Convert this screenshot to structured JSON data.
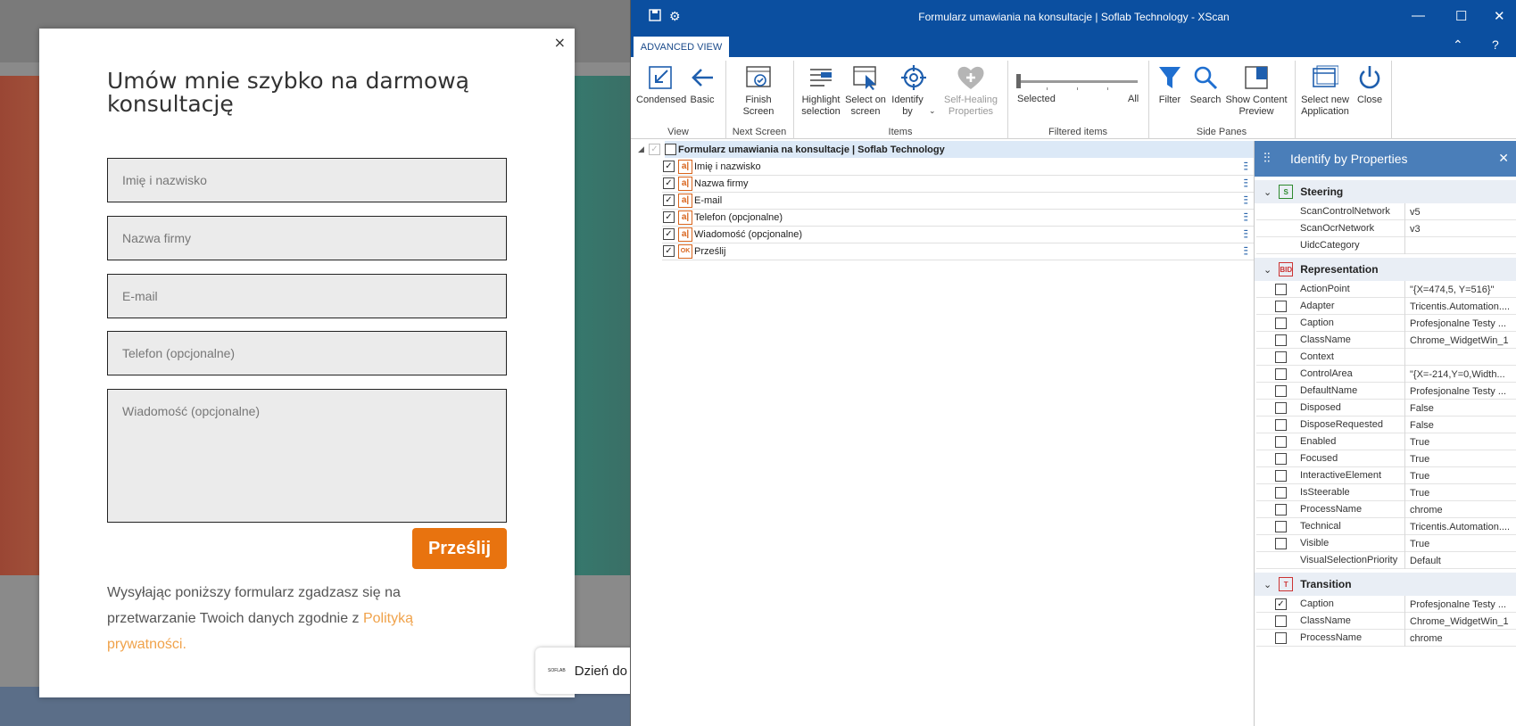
{
  "website": {
    "close_glyph": "×",
    "heading": "Umów mnie szybko na darmową konsultację",
    "fields": [
      {
        "placeholder": "Imię i nazwisko"
      },
      {
        "placeholder": "Nazwa firmy"
      },
      {
        "placeholder": "E-mail"
      },
      {
        "placeholder": "Telefon (opcjonalne)"
      },
      {
        "placeholder": "Wiadomość (opcjonalne)"
      }
    ],
    "submit_label": "Prześlij",
    "consent_text": "Wysyłając poniższy formularz zgadzasz się na przetwarzanie Twoich danych zgodnie z",
    "consent_link": "Polityką prywatności.",
    "toast_logo": "SOFLAB",
    "toast_text": "Dzień do"
  },
  "xscan": {
    "window_title": "Formularz umawiania na konsultacje | Soflab Technology - XScan",
    "active_tab": "ADVANCED VIEW",
    "ribbon": {
      "condensed": "Condensed",
      "basic": "Basic",
      "view_group": "View",
      "finish_screen": "Finish Screen",
      "next_screen_group": "Next Screen",
      "highlight_selection": "Highlight selection",
      "select_on_screen": "Select on screen",
      "identify_by": "Identify by",
      "self_healing": "Self-Healing Properties",
      "items_group": "Items",
      "selected": "Selected",
      "all": "All",
      "filtered_items_group": "Filtered items",
      "filter": "Filter",
      "search": "Search",
      "show_content_preview": "Show Content Preview",
      "select_new_application": "Select new Application",
      "close": "Close",
      "side_panes_group": "Side Panes"
    },
    "tree": {
      "root": "Formularz umawiania na konsultacje | Soflab Technology",
      "items": [
        {
          "label": "Imię i nazwisko",
          "icon": "a|",
          "checked": true
        },
        {
          "label": "Nazwa firmy",
          "icon": "a|",
          "checked": true
        },
        {
          "label": "E-mail",
          "icon": "a|",
          "checked": true
        },
        {
          "label": "Telefon (opcjonalne)",
          "icon": "a|",
          "checked": true
        },
        {
          "label": "Wiadomość (opcjonalne)",
          "icon": "a|",
          "checked": true
        },
        {
          "label": "Prześlij",
          "icon": "OK",
          "checked": true
        }
      ]
    },
    "panel": {
      "title": "Identify by Properties",
      "sections": [
        {
          "name": "Steering",
          "icon": "S",
          "rows": [
            {
              "name": "ScanControlNetwork",
              "value": "v5",
              "checkbox": false
            },
            {
              "name": "ScanOcrNetwork",
              "value": "v3",
              "checkbox": false
            },
            {
              "name": "UidcCategory",
              "value": "",
              "checkbox": false
            }
          ]
        },
        {
          "name": "Representation",
          "icon": "BID",
          "rows": [
            {
              "name": "ActionPoint",
              "value": "\"{X=474,5, Y=516}\"",
              "checkbox": true,
              "checked": false
            },
            {
              "name": "Adapter",
              "value": "Tricentis.Automation....",
              "checkbox": true,
              "checked": false
            },
            {
              "name": "Caption",
              "value": "Profesjonalne Testy ...",
              "checkbox": true,
              "checked": false
            },
            {
              "name": "ClassName",
              "value": "Chrome_WidgetWin_1",
              "checkbox": true,
              "checked": false
            },
            {
              "name": "Context",
              "value": "",
              "checkbox": true,
              "checked": false
            },
            {
              "name": "ControlArea",
              "value": "\"{X=-214,Y=0,Width...",
              "checkbox": true,
              "checked": false
            },
            {
              "name": "DefaultName",
              "value": "Profesjonalne Testy ...",
              "checkbox": true,
              "checked": false
            },
            {
              "name": "Disposed",
              "value": "False",
              "checkbox": true,
              "checked": false
            },
            {
              "name": "DisposeRequested",
              "value": "False",
              "checkbox": true,
              "checked": false
            },
            {
              "name": "Enabled",
              "value": "True",
              "checkbox": true,
              "checked": false
            },
            {
              "name": "Focused",
              "value": "True",
              "checkbox": true,
              "checked": false
            },
            {
              "name": "InteractiveElement",
              "value": "True",
              "checkbox": true,
              "checked": false
            },
            {
              "name": "IsSteerable",
              "value": "True",
              "checkbox": true,
              "checked": false
            },
            {
              "name": "ProcessName",
              "value": "chrome",
              "checkbox": true,
              "checked": false
            },
            {
              "name": "Technical",
              "value": "Tricentis.Automation....",
              "checkbox": true,
              "checked": false
            },
            {
              "name": "Visible",
              "value": "True",
              "checkbox": true,
              "checked": false
            },
            {
              "name": "VisualSelectionPriority",
              "value": "Default",
              "checkbox": false
            }
          ]
        },
        {
          "name": "Transition",
          "icon": "T",
          "rows": [
            {
              "name": "Caption",
              "value": "Profesjonalne Testy ...",
              "checkbox": true,
              "checked": true
            },
            {
              "name": "ClassName",
              "value": "Chrome_WidgetWin_1",
              "checkbox": true,
              "checked": false
            },
            {
              "name": "ProcessName",
              "value": "chrome",
              "checkbox": true,
              "checked": false
            }
          ]
        }
      ]
    }
  }
}
